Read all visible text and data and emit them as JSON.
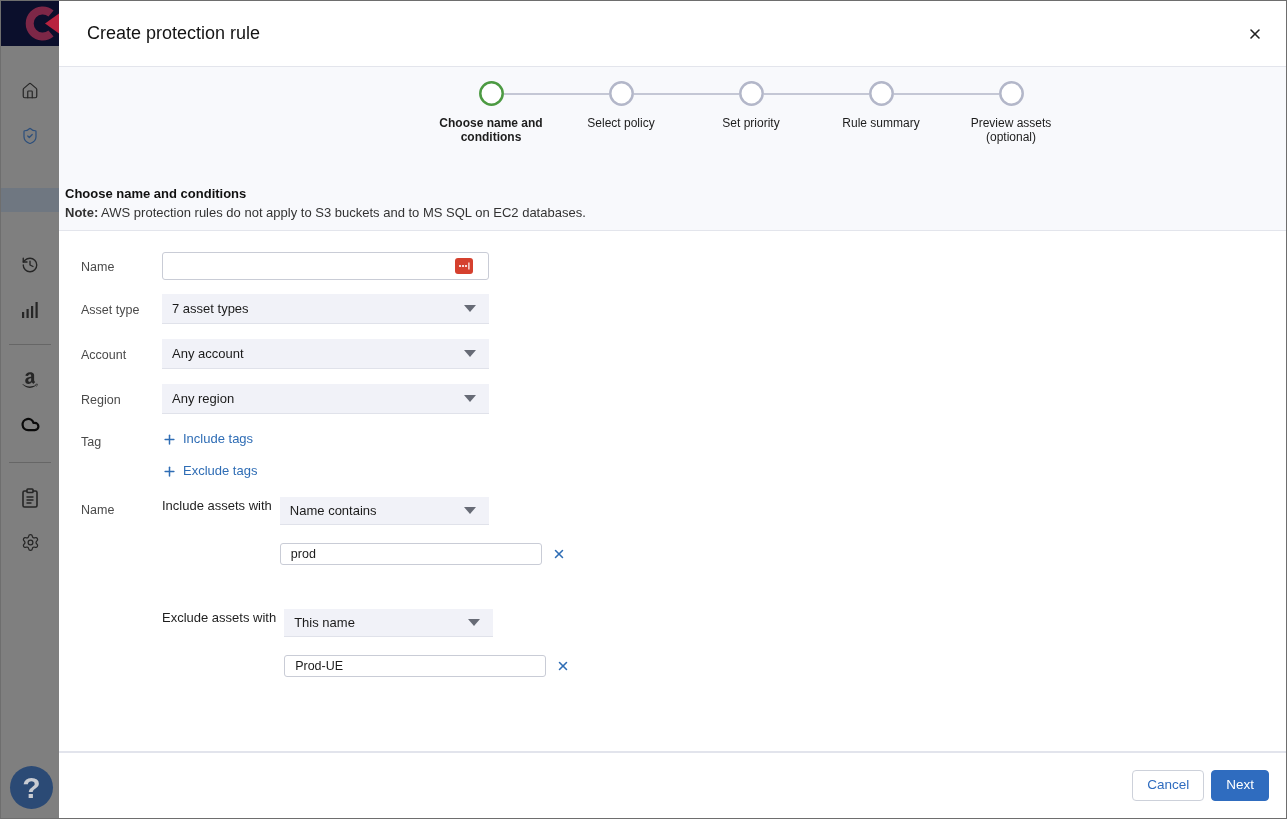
{
  "sidebar": {
    "items": [
      {
        "selected": false
      },
      {
        "selected": true
      },
      {
        "selected": false
      },
      {
        "selected": false
      },
      {
        "selected": false
      },
      {
        "selected": false
      },
      {
        "selected": false
      },
      {
        "selected": false
      }
    ],
    "help_button": {
      "label": "?"
    }
  },
  "dialog": {
    "title": "Create protection rule"
  },
  "stepper": {
    "steps": [
      {
        "label": "Choose name and conditions",
        "selected": true
      },
      {
        "label": "Select policy",
        "selected": false
      },
      {
        "label": "Set priority",
        "selected": false
      },
      {
        "label": "Rule summary",
        "selected": false
      },
      {
        "label": "Preview assets (optional)",
        "selected": false
      }
    ]
  },
  "section": {
    "title": "Choose name and conditions",
    "note": "**Note:** AWS protection rules do not apply to S3 buckets and to MS SQL on EC2 databases."
  },
  "form": {
    "rows": [
      {
        "kind": "text",
        "label": "Name"
      },
      {
        "kind": "select",
        "label": "Asset type",
        "value": "7 asset types"
      },
      {
        "kind": "select",
        "label": "Account",
        "value": "Any account"
      },
      {
        "kind": "select",
        "label": "Region",
        "value": "Any region"
      },
      {
        "kind": "links",
        "label": "Tag",
        "links": [
          "Include tags",
          "Exclude tags"
        ]
      },
      {
        "kind": "filters",
        "label": "Name",
        "filters": [
          {
            "label": "Include assets with",
            "condition": "Name contains",
            "value": "prod"
          },
          {
            "label": "Exclude assets with",
            "condition": "This name",
            "value": "Prod-UE"
          }
        ]
      }
    ]
  },
  "footer": {
    "buttons": [
      {
        "label": "Cancel",
        "kind": "secondary"
      },
      {
        "label": "Next",
        "kind": "primary"
      }
    ]
  }
}
